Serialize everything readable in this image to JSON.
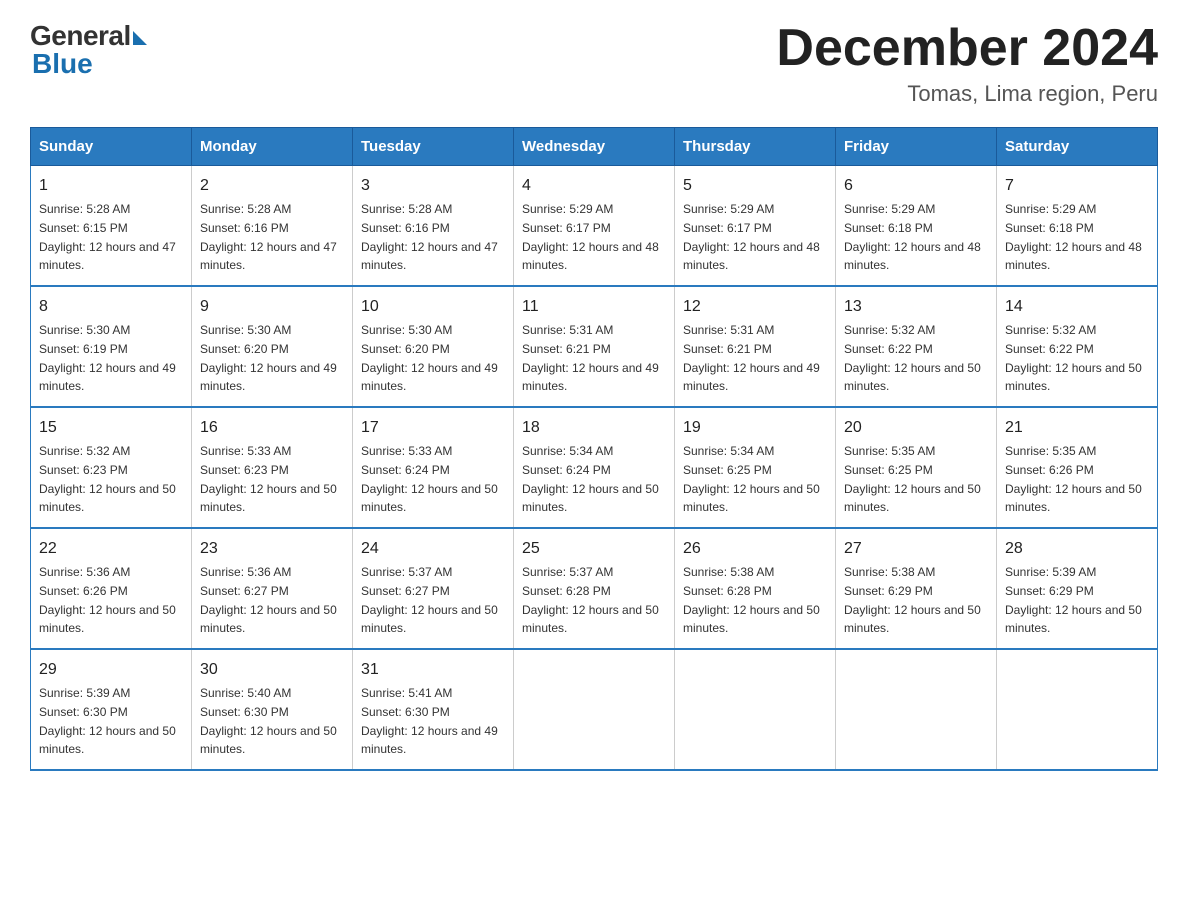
{
  "logo": {
    "general": "General",
    "blue": "Blue"
  },
  "title": "December 2024",
  "location": "Tomas, Lima region, Peru",
  "headers": [
    "Sunday",
    "Monday",
    "Tuesday",
    "Wednesday",
    "Thursday",
    "Friday",
    "Saturday"
  ],
  "weeks": [
    [
      {
        "day": "1",
        "sunrise": "5:28 AM",
        "sunset": "6:15 PM",
        "daylight": "12 hours and 47 minutes."
      },
      {
        "day": "2",
        "sunrise": "5:28 AM",
        "sunset": "6:16 PM",
        "daylight": "12 hours and 47 minutes."
      },
      {
        "day": "3",
        "sunrise": "5:28 AM",
        "sunset": "6:16 PM",
        "daylight": "12 hours and 47 minutes."
      },
      {
        "day": "4",
        "sunrise": "5:29 AM",
        "sunset": "6:17 PM",
        "daylight": "12 hours and 48 minutes."
      },
      {
        "day": "5",
        "sunrise": "5:29 AM",
        "sunset": "6:17 PM",
        "daylight": "12 hours and 48 minutes."
      },
      {
        "day": "6",
        "sunrise": "5:29 AM",
        "sunset": "6:18 PM",
        "daylight": "12 hours and 48 minutes."
      },
      {
        "day": "7",
        "sunrise": "5:29 AM",
        "sunset": "6:18 PM",
        "daylight": "12 hours and 48 minutes."
      }
    ],
    [
      {
        "day": "8",
        "sunrise": "5:30 AM",
        "sunset": "6:19 PM",
        "daylight": "12 hours and 49 minutes."
      },
      {
        "day": "9",
        "sunrise": "5:30 AM",
        "sunset": "6:20 PM",
        "daylight": "12 hours and 49 minutes."
      },
      {
        "day": "10",
        "sunrise": "5:30 AM",
        "sunset": "6:20 PM",
        "daylight": "12 hours and 49 minutes."
      },
      {
        "day": "11",
        "sunrise": "5:31 AM",
        "sunset": "6:21 PM",
        "daylight": "12 hours and 49 minutes."
      },
      {
        "day": "12",
        "sunrise": "5:31 AM",
        "sunset": "6:21 PM",
        "daylight": "12 hours and 49 minutes."
      },
      {
        "day": "13",
        "sunrise": "5:32 AM",
        "sunset": "6:22 PM",
        "daylight": "12 hours and 50 minutes."
      },
      {
        "day": "14",
        "sunrise": "5:32 AM",
        "sunset": "6:22 PM",
        "daylight": "12 hours and 50 minutes."
      }
    ],
    [
      {
        "day": "15",
        "sunrise": "5:32 AM",
        "sunset": "6:23 PM",
        "daylight": "12 hours and 50 minutes."
      },
      {
        "day": "16",
        "sunrise": "5:33 AM",
        "sunset": "6:23 PM",
        "daylight": "12 hours and 50 minutes."
      },
      {
        "day": "17",
        "sunrise": "5:33 AM",
        "sunset": "6:24 PM",
        "daylight": "12 hours and 50 minutes."
      },
      {
        "day": "18",
        "sunrise": "5:34 AM",
        "sunset": "6:24 PM",
        "daylight": "12 hours and 50 minutes."
      },
      {
        "day": "19",
        "sunrise": "5:34 AM",
        "sunset": "6:25 PM",
        "daylight": "12 hours and 50 minutes."
      },
      {
        "day": "20",
        "sunrise": "5:35 AM",
        "sunset": "6:25 PM",
        "daylight": "12 hours and 50 minutes."
      },
      {
        "day": "21",
        "sunrise": "5:35 AM",
        "sunset": "6:26 PM",
        "daylight": "12 hours and 50 minutes."
      }
    ],
    [
      {
        "day": "22",
        "sunrise": "5:36 AM",
        "sunset": "6:26 PM",
        "daylight": "12 hours and 50 minutes."
      },
      {
        "day": "23",
        "sunrise": "5:36 AM",
        "sunset": "6:27 PM",
        "daylight": "12 hours and 50 minutes."
      },
      {
        "day": "24",
        "sunrise": "5:37 AM",
        "sunset": "6:27 PM",
        "daylight": "12 hours and 50 minutes."
      },
      {
        "day": "25",
        "sunrise": "5:37 AM",
        "sunset": "6:28 PM",
        "daylight": "12 hours and 50 minutes."
      },
      {
        "day": "26",
        "sunrise": "5:38 AM",
        "sunset": "6:28 PM",
        "daylight": "12 hours and 50 minutes."
      },
      {
        "day": "27",
        "sunrise": "5:38 AM",
        "sunset": "6:29 PM",
        "daylight": "12 hours and 50 minutes."
      },
      {
        "day": "28",
        "sunrise": "5:39 AM",
        "sunset": "6:29 PM",
        "daylight": "12 hours and 50 minutes."
      }
    ],
    [
      {
        "day": "29",
        "sunrise": "5:39 AM",
        "sunset": "6:30 PM",
        "daylight": "12 hours and 50 minutes."
      },
      {
        "day": "30",
        "sunrise": "5:40 AM",
        "sunset": "6:30 PM",
        "daylight": "12 hours and 50 minutes."
      },
      {
        "day": "31",
        "sunrise": "5:41 AM",
        "sunset": "6:30 PM",
        "daylight": "12 hours and 49 minutes."
      },
      null,
      null,
      null,
      null
    ]
  ]
}
